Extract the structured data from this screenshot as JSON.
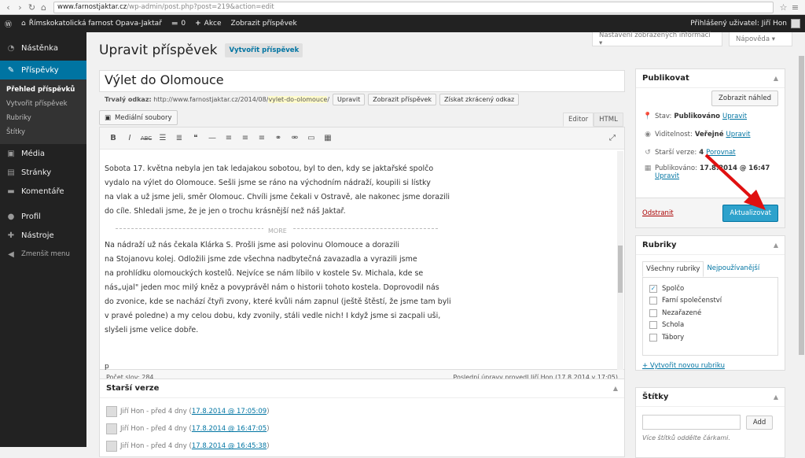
{
  "browser": {
    "url_host": "www.farnostjaktar.cz",
    "url_path": "/wp-admin/post.php?post=219&action=edit"
  },
  "adminbar": {
    "site_name": "Římskokatolická farnost Opava-Jaktař",
    "comments": "0",
    "new": "Akce",
    "view": "Zobrazit příspěvek",
    "user": "Přihlášený uživatel: Jiří Hon"
  },
  "menu": {
    "dashboard": "Nástěnka",
    "posts": "Příspěvky",
    "sub": [
      "Přehled příspěvků",
      "Vytvořit příspěvek",
      "Rubriky",
      "Štítky"
    ],
    "media": "Média",
    "pages": "Stránky",
    "comments": "Komentáře",
    "profile": "Profil",
    "tools": "Nástroje",
    "collapse": "Zmenšit menu"
  },
  "screen": {
    "options": "Nastavení zobrazených informací ▾",
    "help": "Nápověda ▾"
  },
  "page": {
    "title": "Upravit příspěvek",
    "add_new": "Vytvořit příspěvek"
  },
  "post": {
    "title": "Výlet do Olomouce",
    "permalink_label": "Trvalý odkaz:",
    "permalink_base": "http://www.farnostjaktar.cz/2014/08/",
    "permalink_slug": "vylet-do-olomouce",
    "permalink_end": "/",
    "edit": "Upravit",
    "view": "Zobrazit příspěvek",
    "shortlink": "Získat zkrácený odkaz"
  },
  "editor": {
    "media": "Mediální soubory",
    "tab_visual": "Editor",
    "tab_html": "HTML",
    "lines": [
      "Sobota 17. května nebyla jen tak ledajakou sobotou, byl to den, kdy se jaktařské spolčo",
      "vydalo na výlet do Olomouce. Sešli jsme se ráno na východním nádraží, koupili si lístky",
      "na vlak a už jsme jeli, směr Olomouc. Chvíli jsme čekali v Ostravě, ale nakonec jsme dorazili",
      "do cíle. Shledali jsme, že je jen o trochu krásnější než náš Jaktař."
    ],
    "more": "MORE",
    "lines2": [
      "Na nádraží už nás čekala Klárka S. Prošli jsme asi polovinu Olomouce a dorazili",
      "na Stojanovu kolej. Odložili jsme zde všechna nadbytečná zavazadla a vyrazili jsme",
      "na prohlídku olomouckých kostelů. Nejvíce se nám líbilo v kostele Sv. Michala, kde se",
      "nás„ujal\" jeden moc milý kněz a povyprávěl nám o historii tohoto kostela. Doprovodil nás",
      "do zvonice, kde se nachází čtyři zvony, které kvůli nám zapnul (ještě štěstí, že jsme tam byli",
      "v pravé poledne) a my celou dobu, kdy zvonily, stáli vedle nich! I když jsme si zacpali uši,",
      "slyšeli jsme velice dobře."
    ],
    "path": "p",
    "wordcount": "Počet slov: 284",
    "lastedit": "Poslední úpravy provedl Jiří Hon (17.8.2014 v 17:05)"
  },
  "revisions": {
    "title": "Starší verze",
    "items": [
      {
        "author": "Jiří Hon - před 4 dny (",
        "link": "17.8.2014 @ 17:05:09",
        "end": ")"
      },
      {
        "author": "Jiří Hon - před 4 dny (",
        "link": "17.8.2014 @ 16:47:05",
        "end": ")"
      },
      {
        "author": "Jiří Hon - před 4 dny (",
        "link": "17.8.2014 @ 16:45:38",
        "end": ")"
      }
    ]
  },
  "publish": {
    "title": "Publikovat",
    "preview": "Zobrazit náhled",
    "status_label": "Stav:",
    "status_value": "Publikováno",
    "status_edit": "Upravit",
    "vis_label": "Viditelnost:",
    "vis_value": "Veřejné",
    "vis_edit": "Upravit",
    "rev_label": "Starší verze:",
    "rev_value": "4",
    "rev_link": "Porovnat",
    "date_label": "Publikováno:",
    "date_value": "17.8.2014 @ 16:47",
    "date_edit": "Upravit",
    "delete": "Odstranit",
    "update": "Aktualizovat"
  },
  "categories": {
    "title": "Rubriky",
    "tab_all": "Všechny rubriky",
    "tab_popular": "Nejpoužívanější",
    "items": [
      {
        "label": "Spolčo",
        "checked": "✓"
      },
      {
        "label": "Farní společenství",
        "checked": ""
      },
      {
        "label": "Nezařazené",
        "checked": ""
      },
      {
        "label": "Schola",
        "checked": ""
      },
      {
        "label": "Tábory",
        "checked": ""
      }
    ],
    "add_new": "+ Vytvořit novou rubriku"
  },
  "tags": {
    "title": "Štítky",
    "add": "Add",
    "hint": "Více štítků oddělte čárkami."
  },
  "colors": {
    "accent": "#0074a2",
    "update_button": "#2ea2cc",
    "adminbar": "#222222"
  }
}
